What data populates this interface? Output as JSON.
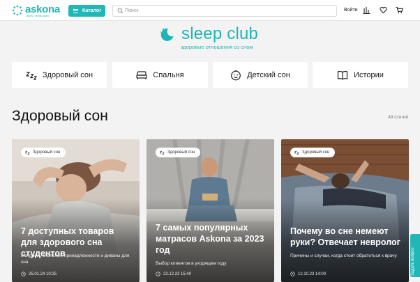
{
  "header": {
    "logo_text": "askona",
    "logo_slogan": "спать, чтобы жить",
    "catalog_label": "Каталог",
    "search_placeholder": "Поиск",
    "login_label": "Войти",
    "icons": [
      "compare-icon",
      "heart-icon",
      "cart-icon"
    ]
  },
  "brand": {
    "title": "sleep club",
    "subtitle": "здоровые отношения со сном"
  },
  "tabs": [
    {
      "label": "Здоровый сон",
      "icon": "zzz-icon"
    },
    {
      "label": "Спальня",
      "icon": "bed-icon"
    },
    {
      "label": "Детский сон",
      "icon": "child-face-icon"
    },
    {
      "label": "Истории",
      "icon": "book-icon"
    }
  ],
  "section": {
    "title": "Здоровый сон",
    "count": "49 статей"
  },
  "cards": [
    {
      "badge": "Здоровый сон",
      "title": "7 доступных товаров для здорового сна студентов",
      "desc": "Матрасы, спальные принадлежности и диваны для сна",
      "date": "25.01.24 10:25"
    },
    {
      "badge": "Здоровый сон",
      "title": "7 самых популярных матрасов Askona за 2023 год",
      "desc": "Выбор клиентов в уходящем году",
      "date": "22.12.23 15:40"
    },
    {
      "badge": "Здоровый сон",
      "title": "Почему во сне немеют руки? Отвечает невролог",
      "desc": "Причины и случаи, когда стоит обратиться к врачу",
      "date": "12.10.23 14:00"
    }
  ],
  "feedback_label": "Задать вопрос",
  "colors": {
    "accent": "#21b7b7",
    "background": "#f3f3f3"
  }
}
